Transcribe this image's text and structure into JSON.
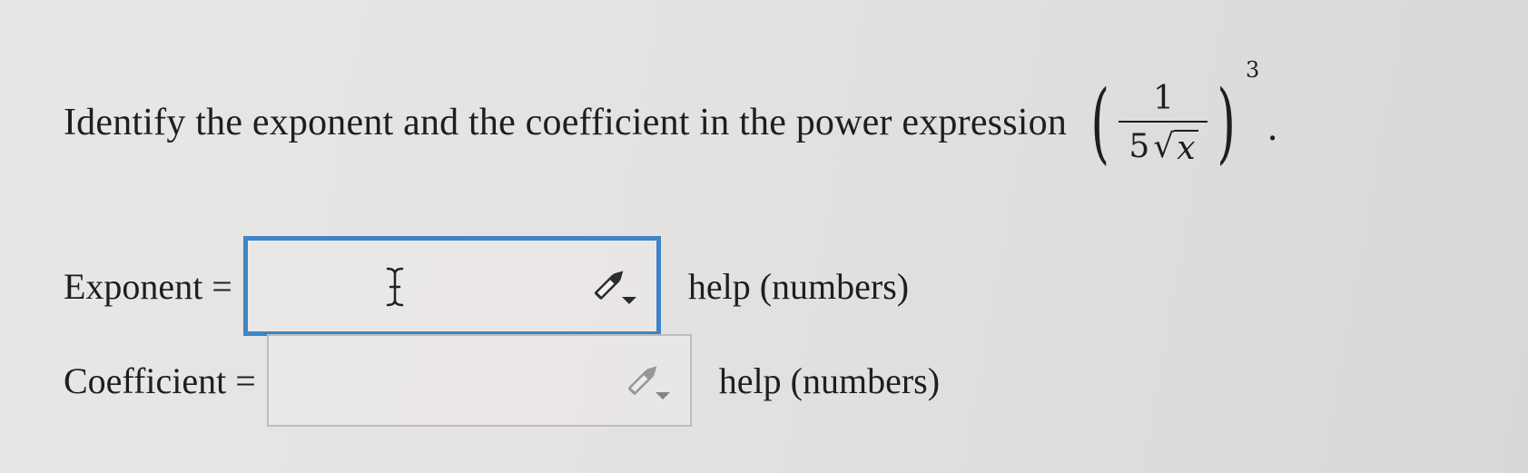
{
  "question": {
    "text": "Identify the exponent and the coefficient in the power expression",
    "expression": {
      "open_paren": "(",
      "numerator": "1",
      "denominator_coefficient": "5",
      "sqrt_symbol": "√",
      "radicand": "x",
      "close_paren": ")",
      "exponent": "3",
      "trailing": "."
    }
  },
  "fields": [
    {
      "label": "Exponent =",
      "value": "",
      "help_text": "help (numbers)",
      "focused": true
    },
    {
      "label": "Coefficient =",
      "value": "",
      "help_text": "help (numbers)",
      "focused": false
    }
  ],
  "icons": {
    "edit": "pencil-dropdown-icon",
    "text_cursor": "text-cursor-icon"
  },
  "colors": {
    "focus_border": "#3f84c6",
    "idle_border": "#bdbdbd",
    "text": "#1e1e1e"
  }
}
